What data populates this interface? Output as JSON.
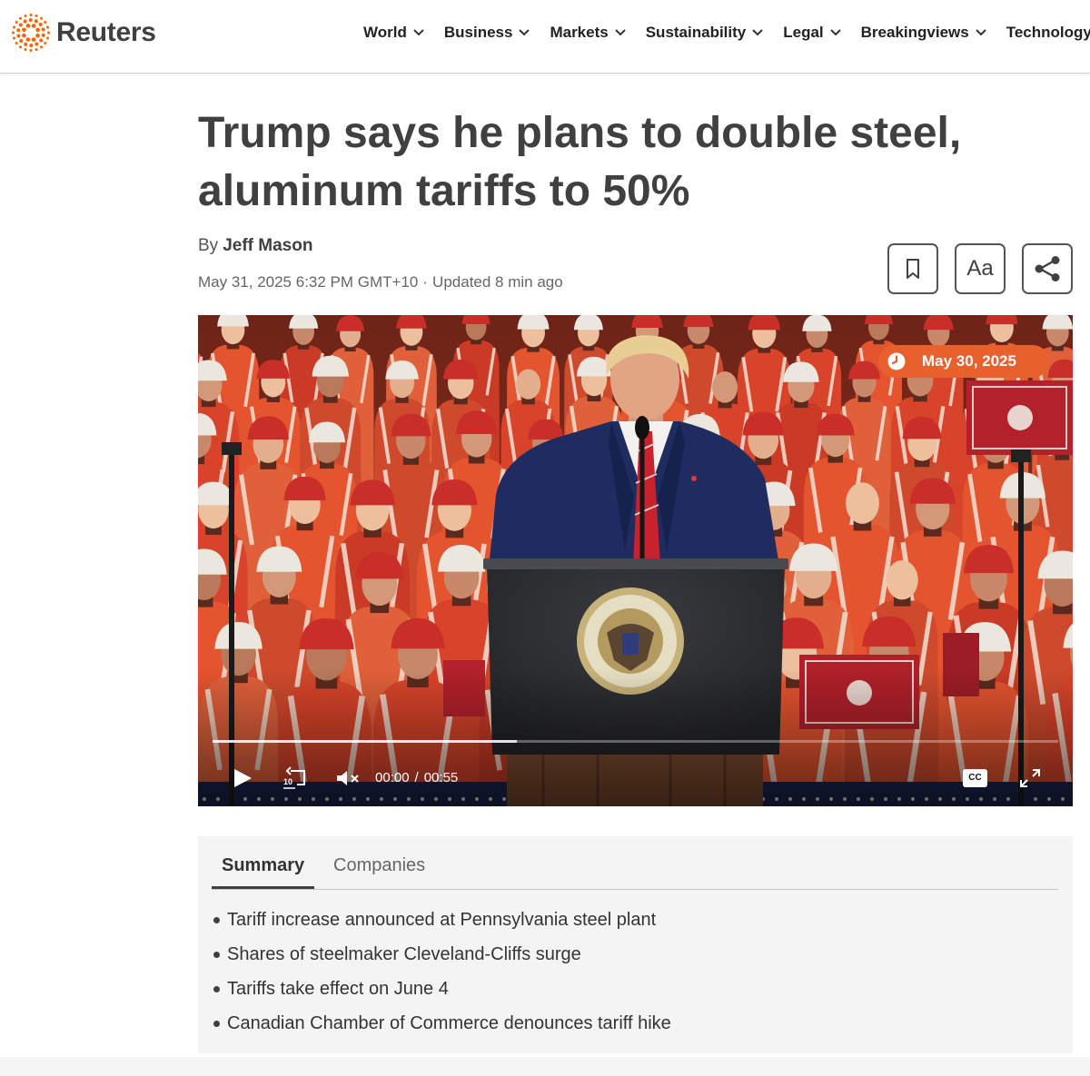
{
  "brand": {
    "name": "Reuters",
    "logo_icon": "reuters-dots-logo-icon",
    "accent_color": "#fa6400"
  },
  "nav": {
    "items": [
      {
        "label": "World",
        "icon": "chevron-down-icon"
      },
      {
        "label": "Business",
        "icon": "chevron-down-icon"
      },
      {
        "label": "Markets",
        "icon": "chevron-down-icon"
      },
      {
        "label": "Sustainability",
        "icon": "chevron-down-icon"
      },
      {
        "label": "Legal",
        "icon": "chevron-down-icon"
      },
      {
        "label": "Breakingviews",
        "icon": "chevron-down-icon"
      },
      {
        "label": "Technology",
        "icon": "chevron-down-icon"
      }
    ]
  },
  "article": {
    "headline": "Trump says he plans to double steel, aluminum tariffs to 50%",
    "byline_prefix": "By",
    "author": "Jeff Mason",
    "published": "May 31, 2025 6:32 PM GMT+10",
    "separator": "·",
    "updated": "Updated 8 min ago"
  },
  "tools": {
    "bookmark": {
      "icon": "bookmark-icon"
    },
    "text_size": {
      "label": "Aa"
    },
    "share": {
      "icon": "share-icon"
    }
  },
  "video": {
    "date_badge": "May 30, 2025",
    "date_badge_icon": "clock-icon",
    "date_badge_color": "#e8602c",
    "current_time": "00:00",
    "time_separator": "/",
    "duration": "00:55",
    "buffered_fraction": 0.36,
    "played_fraction": 0,
    "replay_seconds": "10",
    "captions_label": "CC",
    "controls": {
      "play": "play-icon",
      "replay": "replay-10-icon",
      "mute": "muted-speaker-icon",
      "captions": "closed-captions-icon",
      "fullscreen": "fullscreen-icon"
    }
  },
  "summary": {
    "tabs": [
      {
        "label": "Summary",
        "active": true
      },
      {
        "label": "Companies",
        "active": false
      }
    ],
    "bullets": [
      "Tariff increase announced at Pennsylvania steel plant",
      "Shares of steelmaker Cleveland-Cliffs surge",
      "Tariffs take effect on June 4",
      "Canadian Chamber of Commerce denounces tariff hike"
    ]
  },
  "colors": {
    "text": "#404040",
    "summary_background": "#f4f4f4"
  }
}
